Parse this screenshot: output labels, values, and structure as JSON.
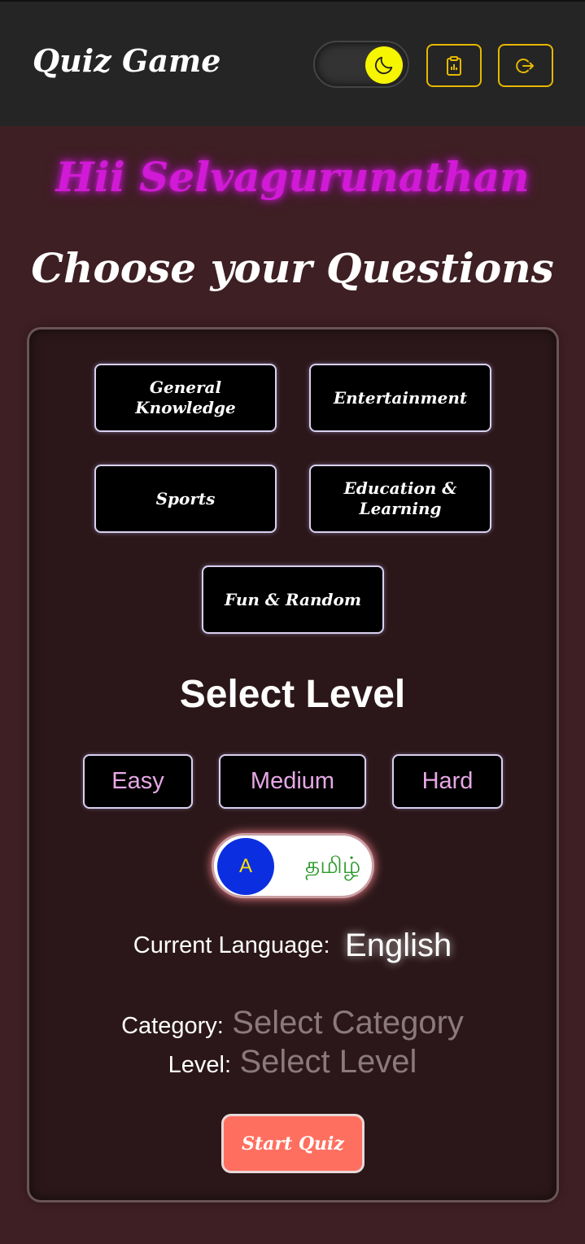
{
  "header": {
    "title": "Quiz Game",
    "theme_toggle_icon": "moon-icon",
    "scoreboard_icon": "clipboard-icon",
    "logout_icon": "logout-icon",
    "accent": "#e6b800",
    "toggle_knob_color": "#f6f600"
  },
  "greeting": "Hii Selvagurunathan",
  "heading": "Choose your Questions",
  "categories": [
    {
      "label": "General Knowledge"
    },
    {
      "label": "Entertainment"
    },
    {
      "label": "Sports"
    },
    {
      "label": "Education & Learning"
    },
    {
      "label": "Fun & Random"
    }
  ],
  "level": {
    "title": "Select Level",
    "options": [
      "Easy",
      "Medium",
      "Hard"
    ]
  },
  "language_toggle": {
    "knob_label": "A",
    "alt_label": "தமிழ்"
  },
  "current_language": {
    "label": "Current Language:",
    "value": "English"
  },
  "summary": {
    "category_label": "Category:",
    "category_value": "Select Category",
    "level_label": "Level:",
    "level_value": "Select Level"
  },
  "start_button": "Start Quiz",
  "colors": {
    "background": "#3e1f23",
    "panel": "#2b1719",
    "greeting": "#d11ad6",
    "start_button": "#ff6f5f",
    "level_text": "#e6a8e6"
  }
}
